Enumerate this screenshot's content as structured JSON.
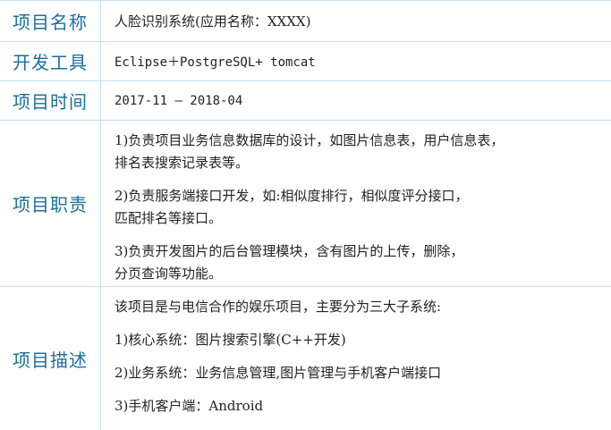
{
  "rows": {
    "project_name": {
      "label": "项目名称",
      "value": "人脸识别系统(应用名称：XXXX)"
    },
    "dev_tools": {
      "label": "开发工具",
      "value": "Eclipse＋PostgreSQL+ tomcat"
    },
    "project_time": {
      "label": "项目时间",
      "value": "2017-11 — 2018-04"
    },
    "responsibilities": {
      "label": "项目职责",
      "items": [
        {
          "line1": "1)负责项目业务信息数据库的设计，如图片信息表，用户信息表，",
          "line2": "排名表搜索记录表等。"
        },
        {
          "line1": "2)负责服务端接口开发，如:相似度排行，相似度评分接口，",
          "line2": "匹配排名等接口。"
        },
        {
          "line1": "3)负责开发图片的后台管理模块，含有图片的上传，删除，",
          "line2": "分页查询等功能。"
        }
      ]
    },
    "description": {
      "label": "项目描述",
      "intro": "该项目是与电信合作的娱乐项目，主要分为三大子系统:",
      "items": [
        "1)核心系统：图片搜索引擎(C++开发)",
        "2)业务系统：业务信息管理,图片管理与手机客户端接口",
        "3)手机客户端：Android"
      ]
    }
  }
}
